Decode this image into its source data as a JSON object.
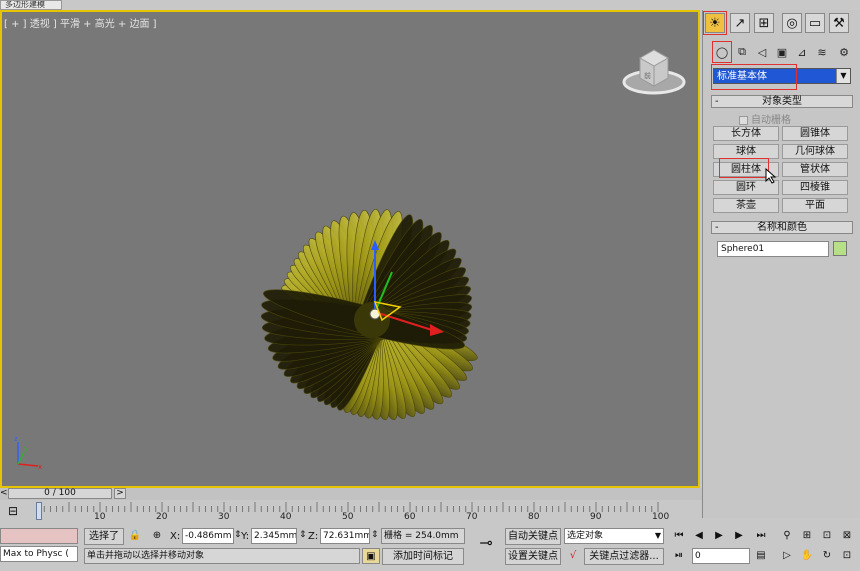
{
  "title_tab": "多边形建模",
  "viewport": {
    "label": "[ + ] 透视 ] 平滑 + 高光 + 边面 ]",
    "viewcube_label": "前"
  },
  "command_panel": {
    "dropdown_value": "标准基本体",
    "rollout_object_type": "对象类型",
    "autogrid_label": "自动栅格",
    "buttons": [
      "长方体",
      "圆锥体",
      "球体",
      "几何球体",
      "圆柱体",
      "管状体",
      "圆环",
      "四棱锥",
      "茶壶",
      "平面"
    ],
    "rollout_name_color": "名称和颜色",
    "object_name": "Sphere01",
    "swatch_color": "#b6df88"
  },
  "timeline": {
    "slider_text": "0 / 100",
    "ticks": [
      "0",
      "10",
      "20",
      "30",
      "40",
      "50",
      "60",
      "70",
      "80",
      "90",
      "100"
    ]
  },
  "status": {
    "script_field": "Max to Physc (",
    "selected_label": "选择了",
    "x_label": "X:",
    "x_value": "-0.486mm",
    "y_label": "Y:",
    "y_value": "2.345mm",
    "z_label": "Z:",
    "z_value": "72.631mm",
    "grid_label": "栅格 = 254.0mm",
    "prompt": "单击并拖动以选择并移动对象",
    "add_time_tag": "添加时间标记",
    "auto_key": "自动关键点",
    "set_key": "设置关键点",
    "selected_object": "选定对象",
    "key_filters": "关键点过滤器...",
    "frame_value": "0"
  },
  "colors": {
    "viewport_border": "#e6c400",
    "model_color": "#b5ad1e",
    "highlight": "#1f57d4",
    "annotation": "#e03030"
  }
}
